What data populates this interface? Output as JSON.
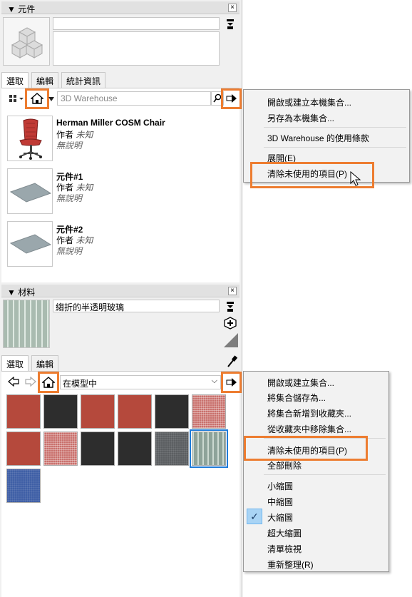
{
  "components": {
    "title": "元件",
    "close": "×",
    "tabs": [
      "選取",
      "編輯",
      "統計資訊"
    ],
    "search_placeholder": "3D Warehouse",
    "items": [
      {
        "name": "Herman Miller COSM Chair",
        "author_label": "作者",
        "author": "未知",
        "desc": "無說明"
      },
      {
        "name": "元件#1",
        "author_label": "作者",
        "author": "未知",
        "desc": "無說明"
      },
      {
        "name": "元件#2",
        "author_label": "作者",
        "author": "未知",
        "desc": "無說明"
      }
    ]
  },
  "materials": {
    "title": "材料",
    "close": "×",
    "material_name": "縐折的半透明玻璃",
    "tabs": [
      "選取",
      "編輯"
    ],
    "collection": "在模型中",
    "swatch_colors": [
      "#b5493c",
      "#2d2d2d",
      "#b5493c",
      "#b5493c",
      "#2d2d2d",
      "#c9706c",
      "#b5493c",
      "#c9706c",
      "#2d2d2d",
      "#2d2d2d",
      "#5b5e61",
      "#8ea39a",
      "#3f5fa6"
    ]
  },
  "menu_top": {
    "items": [
      "開啟或建立本機集合...",
      "另存為本機集合...",
      "3D Warehouse 的使用條款",
      "展開(E)",
      "清除未使用的項目(P)"
    ]
  },
  "menu_bottom": {
    "items": [
      "開啟或建立集合...",
      "將集合儲存為...",
      "將集合新增到收藏夾...",
      "從收藏夾中移除集合...",
      "清除未使用的項目(P)",
      "全部刪除",
      "小縮圖",
      "中縮圖",
      "大縮圖",
      "超大縮圖",
      "清單檢視",
      "重新整理(R)"
    ],
    "checked": "✓"
  },
  "colors": {
    "accent": "#ed7d31",
    "selection": "#1e7bd8"
  }
}
